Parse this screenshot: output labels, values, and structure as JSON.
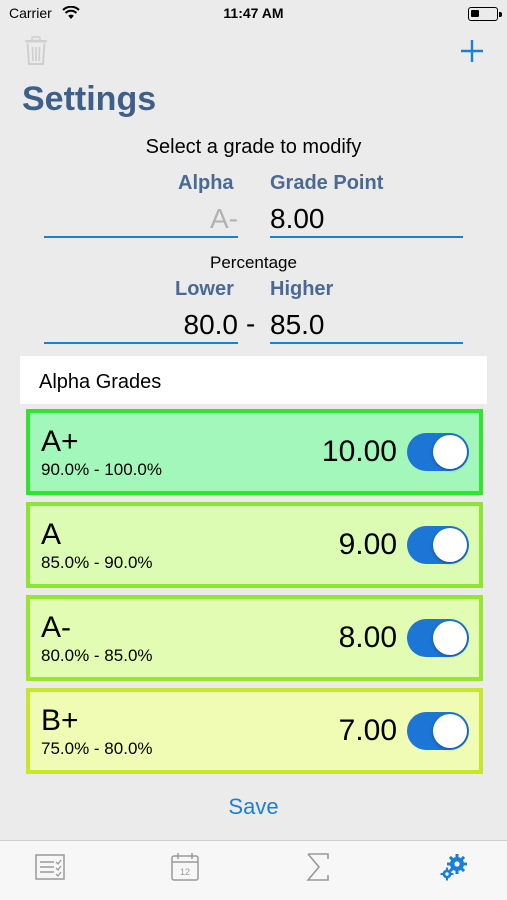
{
  "status_bar": {
    "carrier": "Carrier",
    "time": "11:47 AM"
  },
  "nav": {
    "title": "Settings",
    "left_icon": "trash-icon",
    "right_icon": "add-icon"
  },
  "editor": {
    "prompt": "Select a grade to modify",
    "alpha_label": "Alpha",
    "alpha_value": "A-",
    "grade_point_label": "Grade Point",
    "grade_point_value": "8.00",
    "percentage_label": "Percentage",
    "lower_label": "Lower",
    "lower_value": "80.0",
    "separator": "-",
    "higher_label": "Higher",
    "higher_value": "85.0"
  },
  "grades_section": {
    "header": "Alpha Grades",
    "items": [
      {
        "name": "A+",
        "range": "90.0% - 100.0%",
        "points": "10.00",
        "enabled": true,
        "bg": "#a3f7ba",
        "border": "#2ee62e"
      },
      {
        "name": "A",
        "range": "85.0% - 90.0%",
        "points": "9.00",
        "enabled": true,
        "bg": "#dcfcb4",
        "border": "#8ae62e"
      },
      {
        "name": "A-",
        "range": "80.0% - 85.0%",
        "points": "8.00",
        "enabled": true,
        "bg": "#e2fcb4",
        "border": "#99e62e"
      },
      {
        "name": "B+",
        "range": "75.0% - 80.0%",
        "points": "7.00",
        "enabled": true,
        "bg": "#f0fcb4",
        "border": "#c8e62e"
      }
    ]
  },
  "save_label": "Save",
  "tab_bar": {
    "tabs": [
      {
        "icon": "list-icon",
        "active": false
      },
      {
        "icon": "calendar-icon",
        "label": "12",
        "active": false
      },
      {
        "icon": "sigma-icon",
        "active": false
      },
      {
        "icon": "gears-icon",
        "active": true
      }
    ]
  },
  "colors": {
    "accent": "#1a7fd6",
    "title": "#3d5f8a",
    "label": "#4a6a93"
  }
}
